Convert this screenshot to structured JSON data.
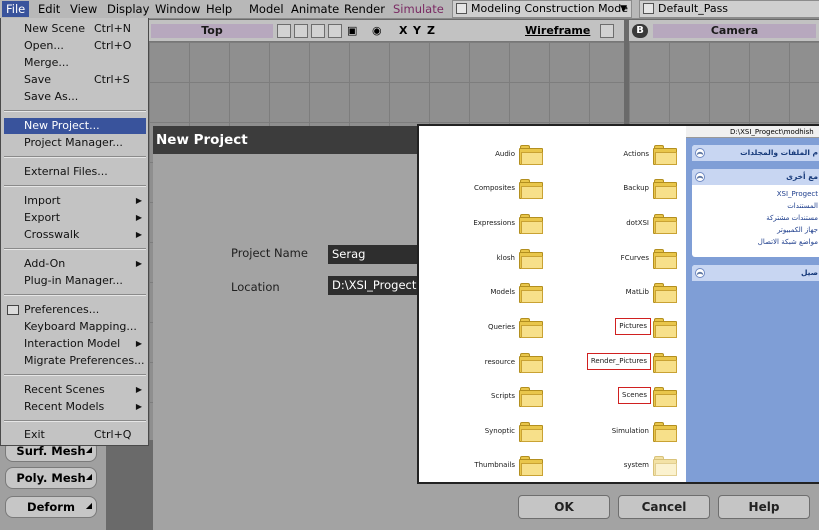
{
  "menubar": {
    "items": [
      "File",
      "Edit",
      "View",
      "Display",
      "Window",
      "Help",
      "Model",
      "Animate",
      "Render",
      "Simulate"
    ],
    "mode": "Modeling Construction Mode",
    "pass": "Default_Pass"
  },
  "viewports": {
    "top": {
      "name": "Top",
      "axes": [
        "X",
        "Y",
        "Z"
      ],
      "shading": "Wireframe"
    },
    "right": {
      "badge": "B",
      "name": "Camera"
    }
  },
  "toolpanel": {
    "buttons": [
      "Surf. Mesh",
      "Poly. Mesh",
      "Deform"
    ]
  },
  "file_menu": {
    "groups": [
      [
        {
          "label": "New Scene",
          "shortcut": "Ctrl+N"
        },
        {
          "label": "Open...",
          "shortcut": "Ctrl+O"
        },
        {
          "label": "Merge..."
        },
        {
          "label": "Save",
          "shortcut": "Ctrl+S"
        },
        {
          "label": "Save As..."
        }
      ],
      [
        {
          "label": "New Project..."
        },
        {
          "label": "Project Manager..."
        }
      ],
      [
        {
          "label": "External Files..."
        }
      ],
      [
        {
          "label": "Import",
          "submenu": true
        },
        {
          "label": "Export",
          "submenu": true
        },
        {
          "label": "Crosswalk",
          "submenu": true
        }
      ],
      [
        {
          "label": "Add-On",
          "submenu": true
        },
        {
          "label": "Plug-in Manager..."
        }
      ],
      [
        {
          "label": "Preferences...",
          "icon": "preferences-icon"
        },
        {
          "label": "Keyboard Mapping..."
        },
        {
          "label": "Interaction Model",
          "submenu": true
        },
        {
          "label": "Migrate Preferences..."
        }
      ],
      [
        {
          "label": "Recent Scenes",
          "submenu": true
        },
        {
          "label": "Recent Models",
          "submenu": true
        }
      ],
      [
        {
          "label": "Exit",
          "shortcut": "Ctrl+Q"
        }
      ]
    ],
    "highlighted": "New Project..."
  },
  "dialog": {
    "title": "New Project",
    "project_name_label": "Project Name",
    "project_name_value": "Serag",
    "location_label": "Location",
    "location_value": "D:\\XSI_Progect",
    "buttons": {
      "ok": "OK",
      "cancel": "Cancel",
      "help": "Help"
    }
  },
  "explorer": {
    "address": "D:\\XSI_Progect\\modhish",
    "folders_left": [
      "Audio",
      "Composites",
      "Expressions",
      "klosh",
      "Models",
      "Queries",
      "resource",
      "Scripts",
      "Synoptic",
      "Thumbnails"
    ],
    "folders_right": [
      "Actions",
      "Backup",
      "dotXSI",
      "FCurves",
      "MatLib",
      "Pictures",
      "Render_Pictures",
      "Scenes",
      "Simulation",
      "system"
    ],
    "highlighted_folders": [
      "Pictures",
      "Render_Pictures",
      "Scenes"
    ],
    "side_panels": {
      "tasks_title": "م الملفات والمجلدات",
      "places_title": "مع أخرى",
      "places_links": [
        "XSI_Progect",
        "المستندات",
        "مستندات مشتركة",
        "جهاز الكمبيوتر",
        "مواضع شبكة الاتصال"
      ],
      "details_title": "صيل"
    }
  }
}
